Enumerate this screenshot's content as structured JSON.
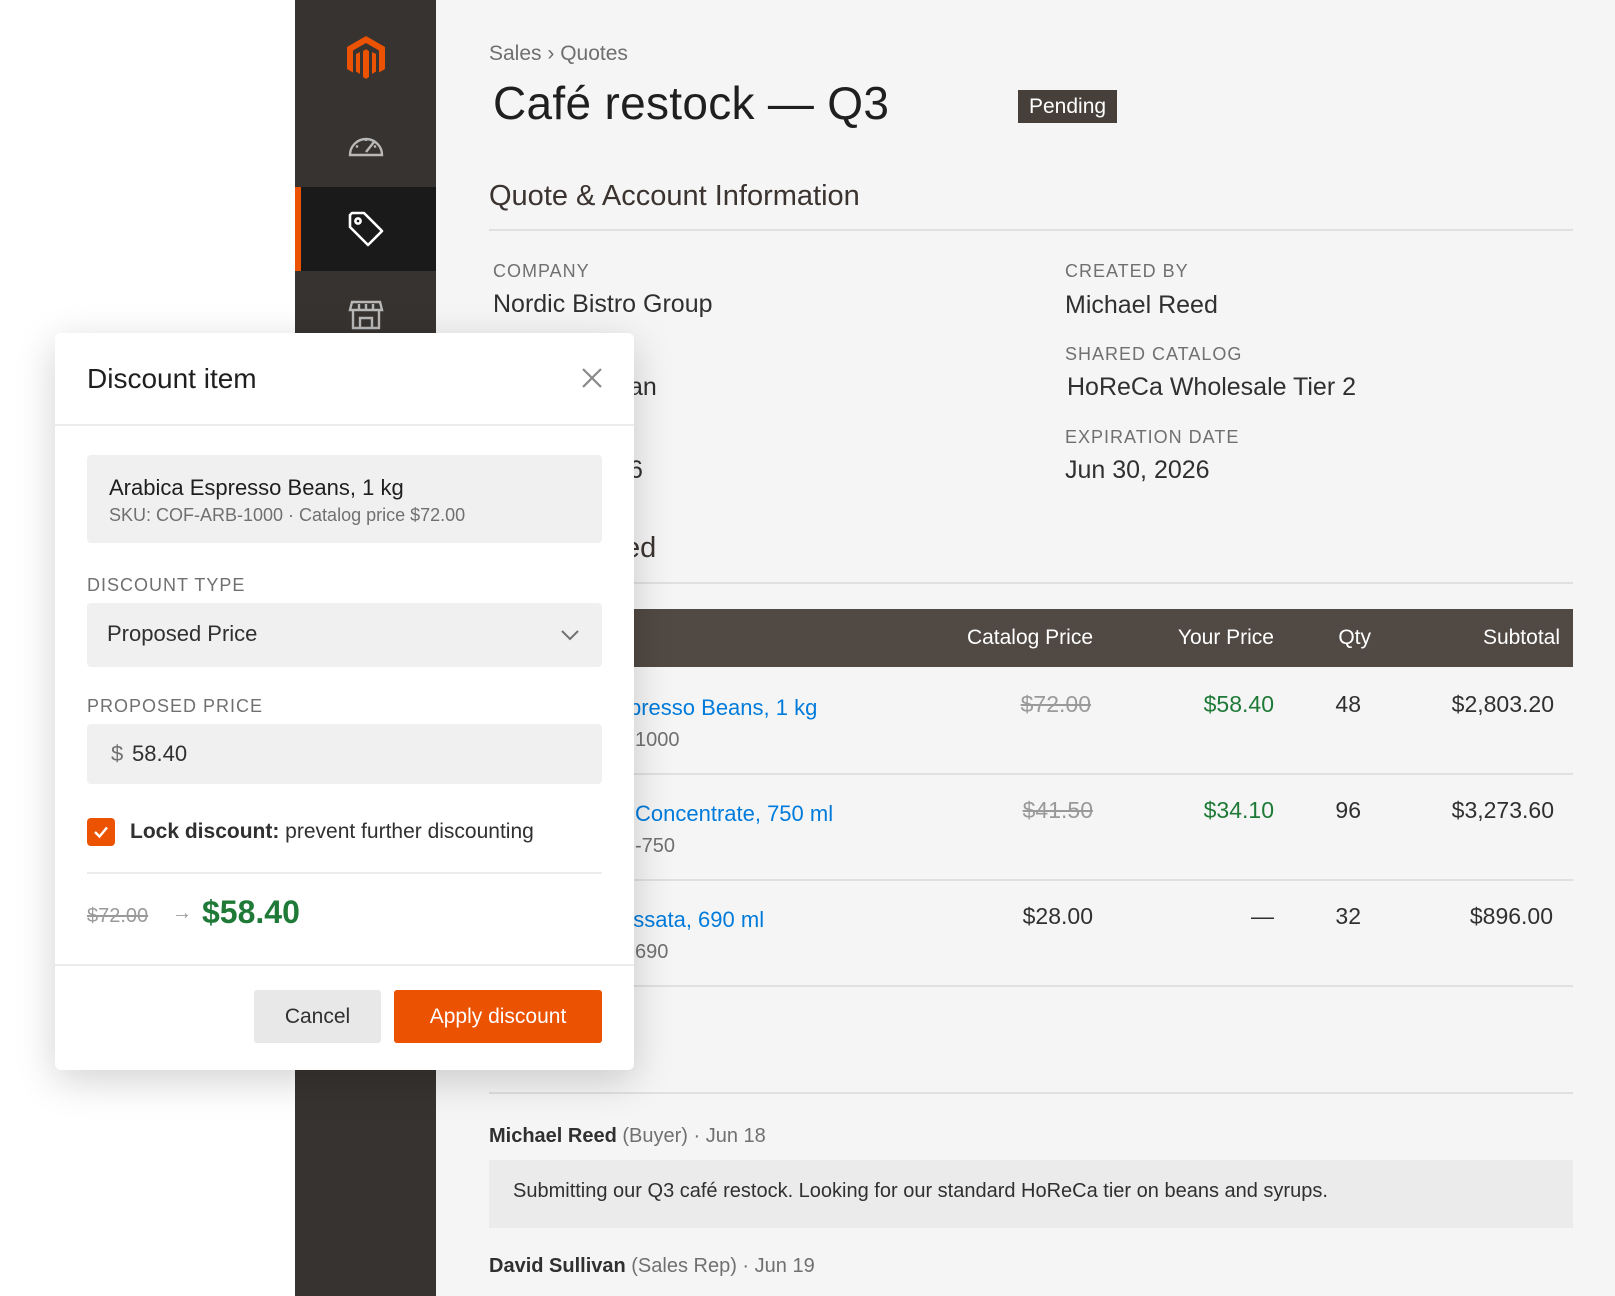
{
  "sidebar": {
    "items": [
      {
        "icon": "magento-logo-icon"
      },
      {
        "icon": "dashboard-gauge-icon"
      },
      {
        "icon": "sales-tag-icon",
        "active": true
      },
      {
        "icon": "store-icon"
      }
    ],
    "accent_color": "#eb5202"
  },
  "header": {
    "breadcrumb": "Sales › Quotes",
    "title": "Café restock — Q3",
    "status": "Pending"
  },
  "account_section": {
    "title": "Quote & Account Information",
    "fields": [
      {
        "label": "COMPANY",
        "value": "Nordic Bistro Group"
      },
      {
        "label": "CREATED BY",
        "value": "Michael Reed"
      },
      {
        "label": "",
        "value": "an"
      },
      {
        "label": "SHARED CATALOG",
        "value": "HoReCa Wholesale Tier 2"
      },
      {
        "label": "",
        "value": "6"
      },
      {
        "label": "EXPIRATION DATE",
        "value": "Jun 30, 2026"
      }
    ]
  },
  "items_section": {
    "title_fragment": "ted",
    "columns": [
      "Catalog Price",
      "Your Price",
      "Qty",
      "Subtotal"
    ],
    "rows": [
      {
        "name": "spresso Beans, 1 kg",
        "sku": "1000",
        "catalog_price": "$72.00",
        "catalog_struck": true,
        "your_price": "$58.40",
        "qty": "48",
        "subtotal": "$2,803.20"
      },
      {
        "name": "Concentrate, 750 ml",
        "sku": "-750",
        "catalog_price": "$41.50",
        "catalog_struck": true,
        "your_price": "$34.10",
        "qty": "96",
        "subtotal": "$3,273.60"
      },
      {
        "name": "assata, 690 ml",
        "sku": "690",
        "catalog_price": "$28.00",
        "catalog_struck": false,
        "your_price": "—",
        "qty": "32",
        "subtotal": "$896.00"
      }
    ]
  },
  "negotiation": {
    "notes": [
      {
        "author": "Michael Reed",
        "meta": " (Buyer) · Jun 18",
        "text": "Submitting our Q3 café restock. Looking for our standard HoReCa tier on beans and syrups."
      },
      {
        "author": "David Sullivan",
        "meta": " (Sales Rep) · Jun 19"
      }
    ]
  },
  "modal": {
    "title": "Discount item",
    "product_name": "Arabica Espresso Beans, 1 kg",
    "product_meta": "SKU: COF-ARB-1000 · Catalog price $72.00",
    "discount_type_label": "DISCOUNT TYPE",
    "discount_type_value": "Proposed Price",
    "proposed_price_label": "PROPOSED PRICE",
    "currency_symbol": "$",
    "proposed_price_value": "58.40",
    "lock_checked": true,
    "lock_label_bold": "Lock discount:",
    "lock_label_rest": " prevent further discounting",
    "old_price": "$72.00",
    "arrow": "→",
    "new_price": "$58.40",
    "cancel_label": "Cancel",
    "apply_label": "Apply discount"
  }
}
